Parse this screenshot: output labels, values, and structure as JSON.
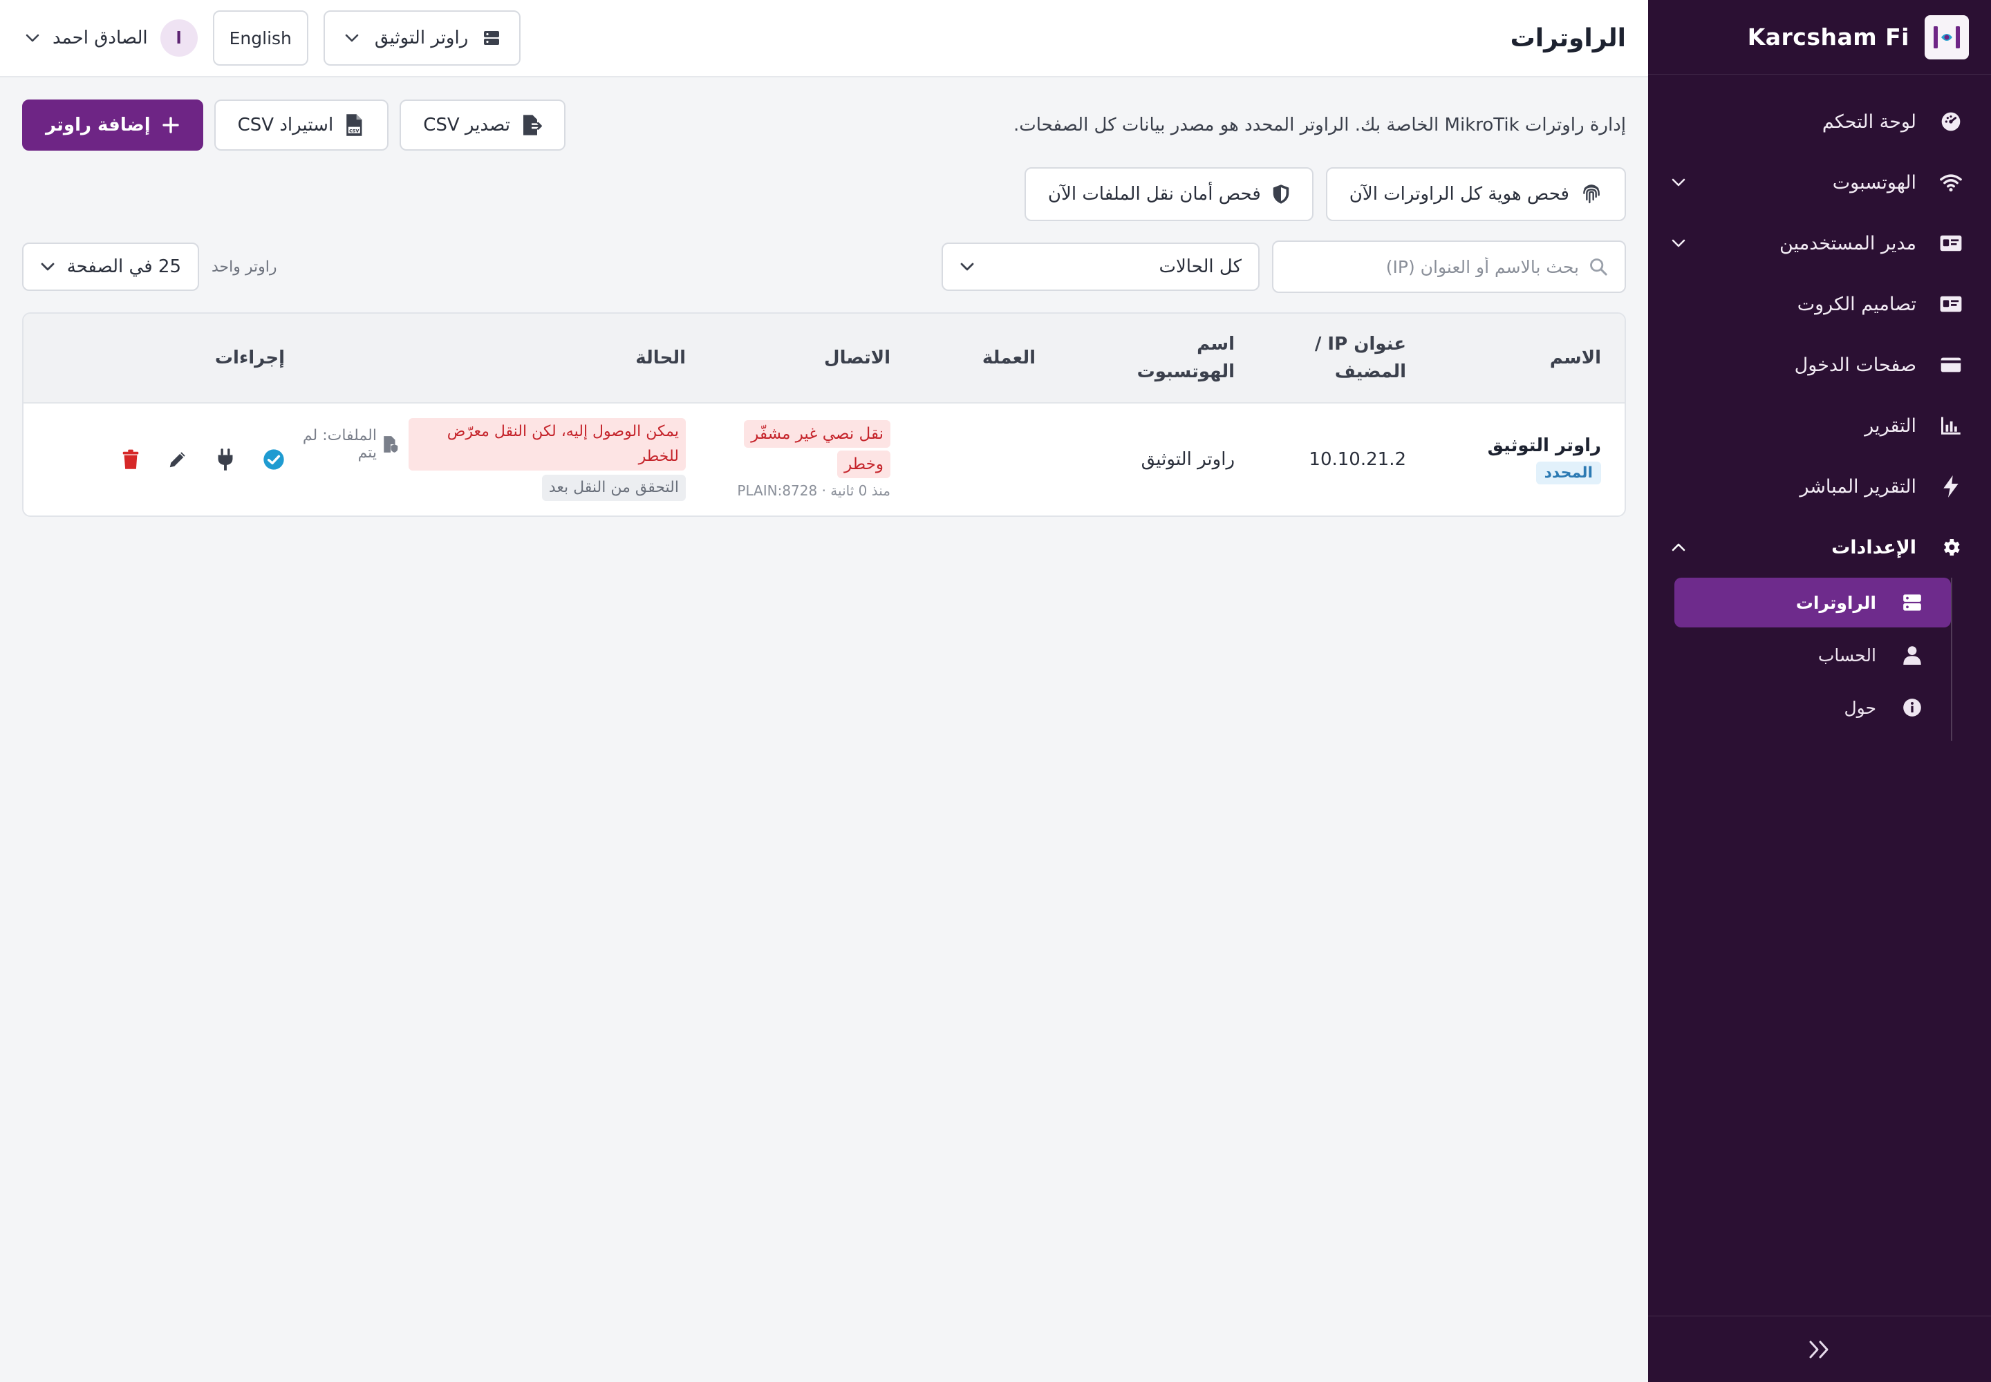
{
  "brand": {
    "name": "Karcsham Fi"
  },
  "sidebar": {
    "items": [
      {
        "label": "لوحة التحكم",
        "icon": "dashboard-gauge-icon"
      },
      {
        "label": "الهوتسبوت",
        "icon": "wifi-icon",
        "expandable": true
      },
      {
        "label": "مدير المستخدمين",
        "icon": "id-card-icon",
        "expandable": true
      },
      {
        "label": "تصاميم الكروت",
        "icon": "id-card-icon"
      },
      {
        "label": "صفحات الدخول",
        "icon": "card-icon"
      },
      {
        "label": "التقرير",
        "icon": "bar-chart-icon"
      },
      {
        "label": "التقرير المباشر",
        "icon": "bolt-icon"
      },
      {
        "label": "الإعدادات",
        "icon": "gear-icon",
        "expanded": true
      }
    ],
    "settings_sub": [
      {
        "label": "الراوترات",
        "icon": "server-icon",
        "active": true
      },
      {
        "label": "الحساب",
        "icon": "user-icon"
      },
      {
        "label": "حول",
        "icon": "info-icon"
      }
    ]
  },
  "topbar": {
    "title": "الراوترات",
    "router_select": "راوتر التوثيق",
    "language": "English",
    "user_initial": "ا",
    "user_name": "الصادق احمد"
  },
  "main": {
    "description": "إدارة راوترات MikroTik الخاصة بك. الراوتر المحدد هو مصدر بيانات كل الصفحات.",
    "export_csv": "تصدير CSV",
    "import_csv": "استيراد CSV",
    "add_router": "إضافة راوتر",
    "scan_identity": "فحص هوية كل الراوترات الآن",
    "scan_transfer": "فحص أمان نقل الملفات الآن",
    "search_placeholder": "بحث بالاسم أو العنوان (IP)",
    "status_filter": "كل الحالات",
    "count_label": "راوتر واحد",
    "per_page": "25 في الصفحة"
  },
  "table": {
    "headers": {
      "name": "الاسم",
      "ip_line1": "عنوان IP /",
      "ip_line2": "المضيف",
      "hotspot_line1": "اسم",
      "hotspot_line2": "الهوتسبوت",
      "currency": "العملة",
      "connection": "الاتصال",
      "status": "الحالة",
      "actions": "إجراءات"
    },
    "rows": [
      {
        "name": "راوتر التوثيق",
        "badge": "المحدد",
        "ip": "10.10.21.2",
        "hotspot": "راوتر التوثيق",
        "currency": "",
        "conn_warning_line1": "نقل نصي غير مشفّر",
        "conn_warning_line2": "وخطر",
        "conn_meta": "منذ 0 ثانية · PLAIN:8728",
        "status_warning": "يمكن الوصول إليه، لكن النقل معرّض للخطر",
        "files_note": "الملفات: لم يتم",
        "files_note2": "التحقق من النقل بعد"
      }
    ]
  },
  "colors": {
    "sidebar_bg": "#2b1033",
    "accent": "#6e2585",
    "active_nav": "#6e2b8c",
    "danger": "#c5242b",
    "info": "#1f9bd1"
  }
}
